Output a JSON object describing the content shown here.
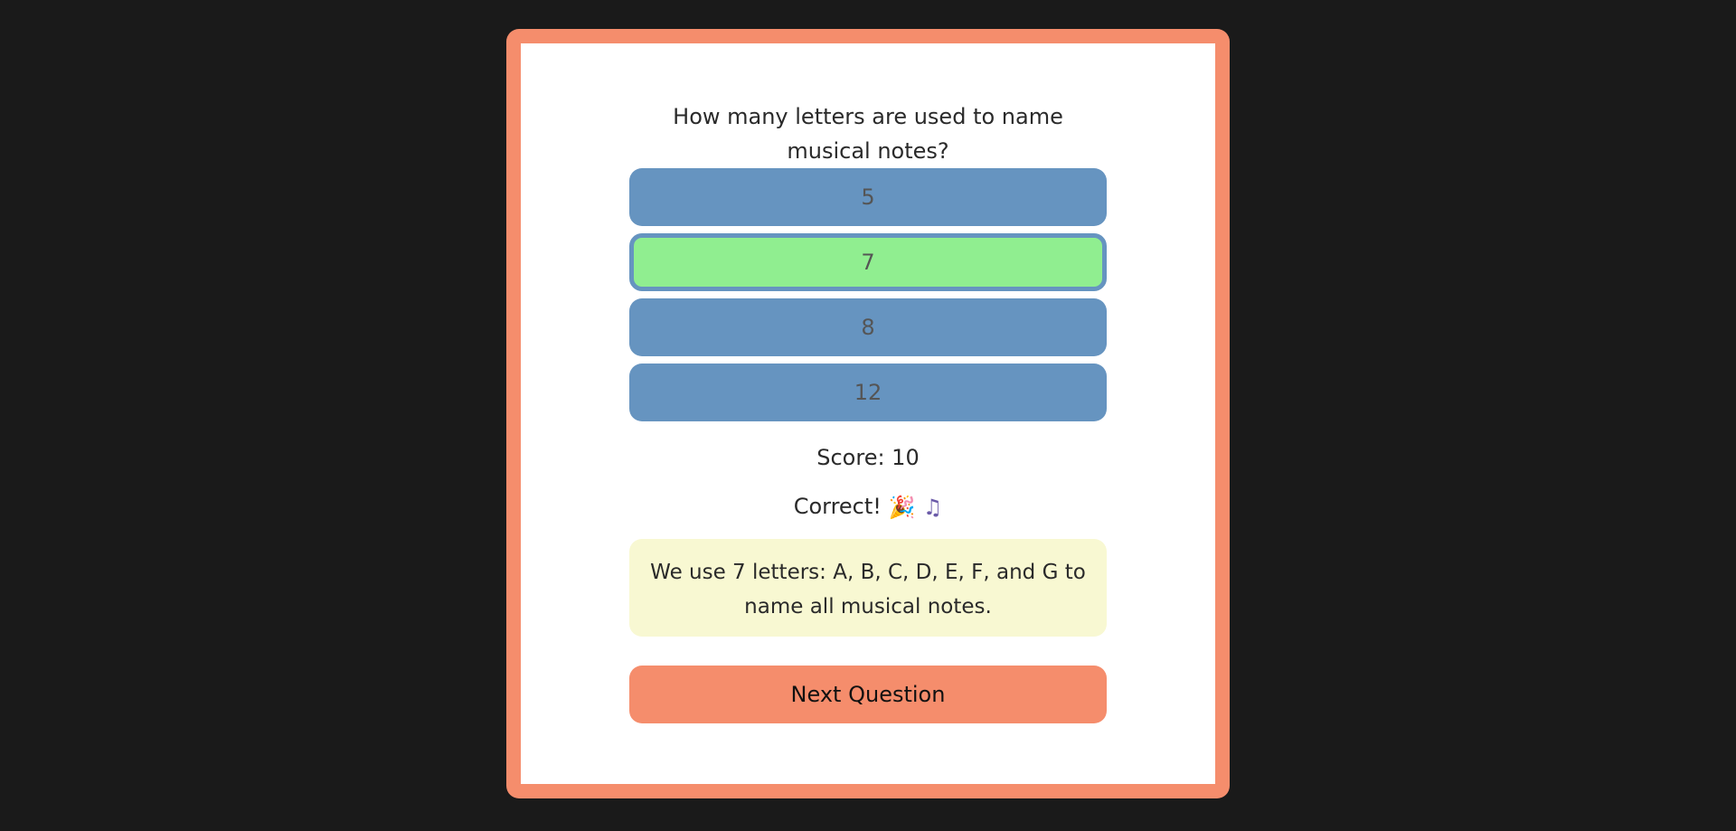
{
  "quiz": {
    "question": "How many letters are used to name musical notes?",
    "options": [
      "5",
      "7",
      "8",
      "12"
    ],
    "selected_option": "7",
    "score_text": "Score: 10",
    "result_text": "Correct!",
    "result_icons": [
      "party-popper-icon",
      "musical-notes-icon"
    ],
    "explanation": "We use 7 letters: A, B, C, D, E, F, and G to name all musical notes.",
    "next_label": "Next Question"
  },
  "colors": {
    "page_background": "#1a1a1a",
    "frame_border": "#f58d6c",
    "option_default": "#6694c0",
    "option_correct": "#90ee90",
    "explanation_background": "#f8f8d2",
    "next_button": "#f58d6c"
  }
}
